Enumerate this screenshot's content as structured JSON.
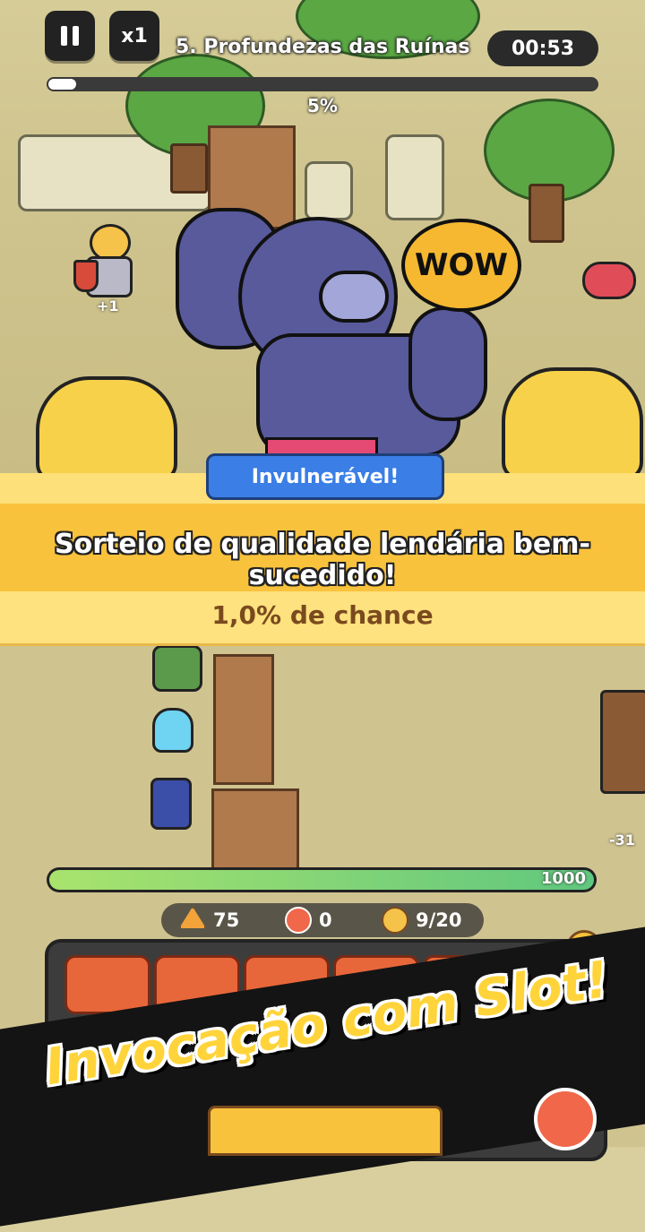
{
  "hud": {
    "pause_label": "II",
    "speed_label": "x1",
    "stage_title": "5. Profundezas das Ruínas",
    "timer": "00:53",
    "progress_percent": 5,
    "progress_label": "5%"
  },
  "popup": {
    "status_pill": "Invulnerável!",
    "message": "Sorteio de qualidade lendária bem-sucedido!",
    "chance": "1,0% de chance",
    "speech_bubble": "WOW"
  },
  "battle": {
    "bonus_label": "+1",
    "damage_label": "-31"
  },
  "base": {
    "hp_value": "1000",
    "hp_fraction": 1.0
  },
  "resources": {
    "gold": "75",
    "gems": "0",
    "units": "9/20"
  },
  "promo": {
    "headline": "Invocação com Slot!"
  },
  "colors": {
    "banner_yellow": "#f9c23c",
    "pill_blue": "#3a7ee6",
    "hp_green": "#5fc77f",
    "headline_yellow": "#ffd43b"
  }
}
